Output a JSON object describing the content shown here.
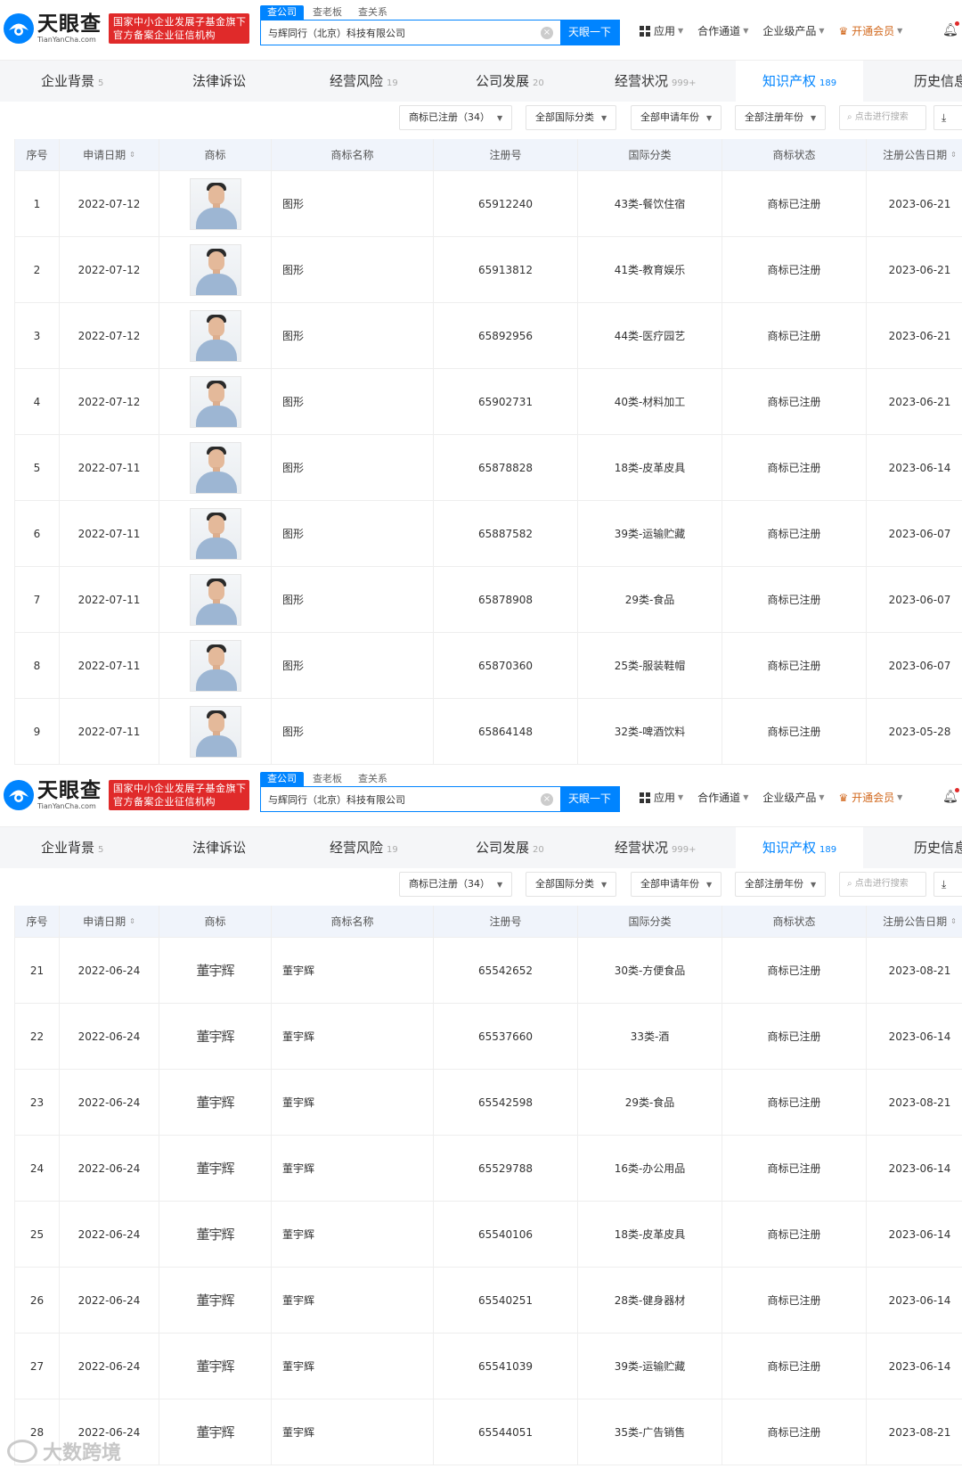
{
  "header": {
    "logo_cn": "天眼查",
    "logo_en": "TianYanCha.com",
    "badge_line1": "国家中小企业发展子基金旗下",
    "badge_line2": "官方备案企业征信机构",
    "search_tabs": [
      "查公司",
      "查老板",
      "查关系"
    ],
    "search_value": "与辉同行（北京）科技有限公司",
    "search_button": "天眼一下",
    "nav": [
      "应用",
      "合作通道",
      "企业级产品",
      "开通会员"
    ]
  },
  "tabs": [
    {
      "label": "企业背景",
      "count": "5"
    },
    {
      "label": "法律诉讼",
      "count": ""
    },
    {
      "label": "经营风险",
      "count": "19"
    },
    {
      "label": "公司发展",
      "count": "20"
    },
    {
      "label": "经营状况",
      "count": "999+"
    },
    {
      "label": "知识产权",
      "count": "189"
    },
    {
      "label": "历史信息",
      "count": ""
    }
  ],
  "filters": {
    "status": "商标已注册（34）",
    "intl_class": "全部国际分类",
    "apply_year": "全部申请年份",
    "reg_year": "全部注册年份",
    "search_placeholder": "点击进行搜索"
  },
  "columns": [
    "序号",
    "申请日期",
    "商标",
    "商标名称",
    "注册号",
    "国际分类",
    "商标状态",
    "注册公告日期"
  ],
  "rows_a": [
    {
      "no": "1",
      "date": "2022-07-12",
      "name": "图形",
      "reg": "65912240",
      "cls": "43类-餐饮住宿",
      "status": "商标已注册",
      "pub": "2023-06-21"
    },
    {
      "no": "2",
      "date": "2022-07-12",
      "name": "图形",
      "reg": "65913812",
      "cls": "41类-教育娱乐",
      "status": "商标已注册",
      "pub": "2023-06-21"
    },
    {
      "no": "3",
      "date": "2022-07-12",
      "name": "图形",
      "reg": "65892956",
      "cls": "44类-医疗园艺",
      "status": "商标已注册",
      "pub": "2023-06-21"
    },
    {
      "no": "4",
      "date": "2022-07-12",
      "name": "图形",
      "reg": "65902731",
      "cls": "40类-材料加工",
      "status": "商标已注册",
      "pub": "2023-06-21"
    },
    {
      "no": "5",
      "date": "2022-07-11",
      "name": "图形",
      "reg": "65878828",
      "cls": "18类-皮革皮具",
      "status": "商标已注册",
      "pub": "2023-06-14"
    },
    {
      "no": "6",
      "date": "2022-07-11",
      "name": "图形",
      "reg": "65887582",
      "cls": "39类-运输贮藏",
      "status": "商标已注册",
      "pub": "2023-06-07"
    },
    {
      "no": "7",
      "date": "2022-07-11",
      "name": "图形",
      "reg": "65878908",
      "cls": "29类-食品",
      "status": "商标已注册",
      "pub": "2023-06-07"
    },
    {
      "no": "8",
      "date": "2022-07-11",
      "name": "图形",
      "reg": "65870360",
      "cls": "25类-服装鞋帽",
      "status": "商标已注册",
      "pub": "2023-06-07"
    },
    {
      "no": "9",
      "date": "2022-07-11",
      "name": "图形",
      "reg": "65864148",
      "cls": "32类-啤酒饮料",
      "status": "商标已注册",
      "pub": "2023-05-28"
    }
  ],
  "rows_b": [
    {
      "no": "21",
      "date": "2022-06-24",
      "mark": "董宇辉",
      "name": "董宇辉",
      "reg": "65542652",
      "cls": "30类-方便食品",
      "status": "商标已注册",
      "pub": "2023-08-21"
    },
    {
      "no": "22",
      "date": "2022-06-24",
      "mark": "董宇辉",
      "name": "董宇辉",
      "reg": "65537660",
      "cls": "33类-酒",
      "status": "商标已注册",
      "pub": "2023-06-14"
    },
    {
      "no": "23",
      "date": "2022-06-24",
      "mark": "董宇辉",
      "name": "董宇辉",
      "reg": "65542598",
      "cls": "29类-食品",
      "status": "商标已注册",
      "pub": "2023-08-21"
    },
    {
      "no": "24",
      "date": "2022-06-24",
      "mark": "董宇辉",
      "name": "董宇辉",
      "reg": "65529788",
      "cls": "16类-办公用品",
      "status": "商标已注册",
      "pub": "2023-06-14"
    },
    {
      "no": "25",
      "date": "2022-06-24",
      "mark": "董宇辉",
      "name": "董宇辉",
      "reg": "65540106",
      "cls": "18类-皮革皮具",
      "status": "商标已注册",
      "pub": "2023-06-14"
    },
    {
      "no": "26",
      "date": "2022-06-24",
      "mark": "董宇辉",
      "name": "董宇辉",
      "reg": "65540251",
      "cls": "28类-健身器材",
      "status": "商标已注册",
      "pub": "2023-06-14"
    },
    {
      "no": "27",
      "date": "2022-06-24",
      "mark": "董宇辉",
      "name": "董宇辉",
      "reg": "65541039",
      "cls": "39类-运输贮藏",
      "status": "商标已注册",
      "pub": "2023-06-14"
    },
    {
      "no": "28",
      "date": "2022-06-24",
      "mark": "董宇辉",
      "name": "董宇辉",
      "reg": "65544051",
      "cls": "35类-广告销售",
      "status": "商标已注册",
      "pub": "2023-08-21"
    }
  ],
  "watermark": "大数跨境",
  "colors": {
    "brand_blue": "#0084ff",
    "badge_red": "#e02a2a",
    "header_row": "#f0f4fb"
  }
}
